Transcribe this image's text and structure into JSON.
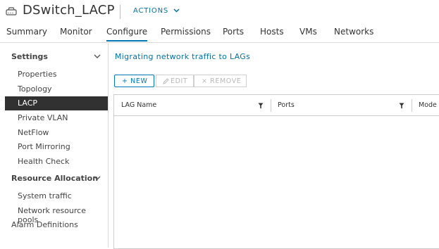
{
  "header": {
    "title": "DSwitch_LACP",
    "actions_label": "ACTIONS"
  },
  "tabs": [
    {
      "label": "Summary"
    },
    {
      "label": "Monitor"
    },
    {
      "label": "Configure"
    },
    {
      "label": "Permissions"
    },
    {
      "label": "Ports"
    },
    {
      "label": "Hosts"
    },
    {
      "label": "VMs"
    },
    {
      "label": "Networks"
    }
  ],
  "active_tab": "Configure",
  "sidebar": {
    "settings_label": "Settings",
    "settings_items": [
      {
        "label": "Properties"
      },
      {
        "label": "Topology"
      },
      {
        "label": "LACP"
      },
      {
        "label": "Private VLAN"
      },
      {
        "label": "NetFlow"
      },
      {
        "label": "Port Mirroring"
      },
      {
        "label": "Health Check"
      }
    ],
    "resource_label": "Resource Allocation",
    "resource_items": [
      {
        "label": "System traffic"
      },
      {
        "label": "Network resource pools"
      }
    ],
    "alarm_label": "Alarm Definitions",
    "active_item": "LACP"
  },
  "main": {
    "section_title": "Migrating network traffic to LAGs",
    "buttons": {
      "new": "+ NEW",
      "edit": "EDIT",
      "remove": "× REMOVE"
    },
    "columns": [
      {
        "label": "LAG Name"
      },
      {
        "label": "Ports"
      },
      {
        "label": "Mode"
      }
    ]
  },
  "colors": {
    "accent": "#0079b8",
    "link": "#0072a3",
    "active_bg": "#313131"
  }
}
